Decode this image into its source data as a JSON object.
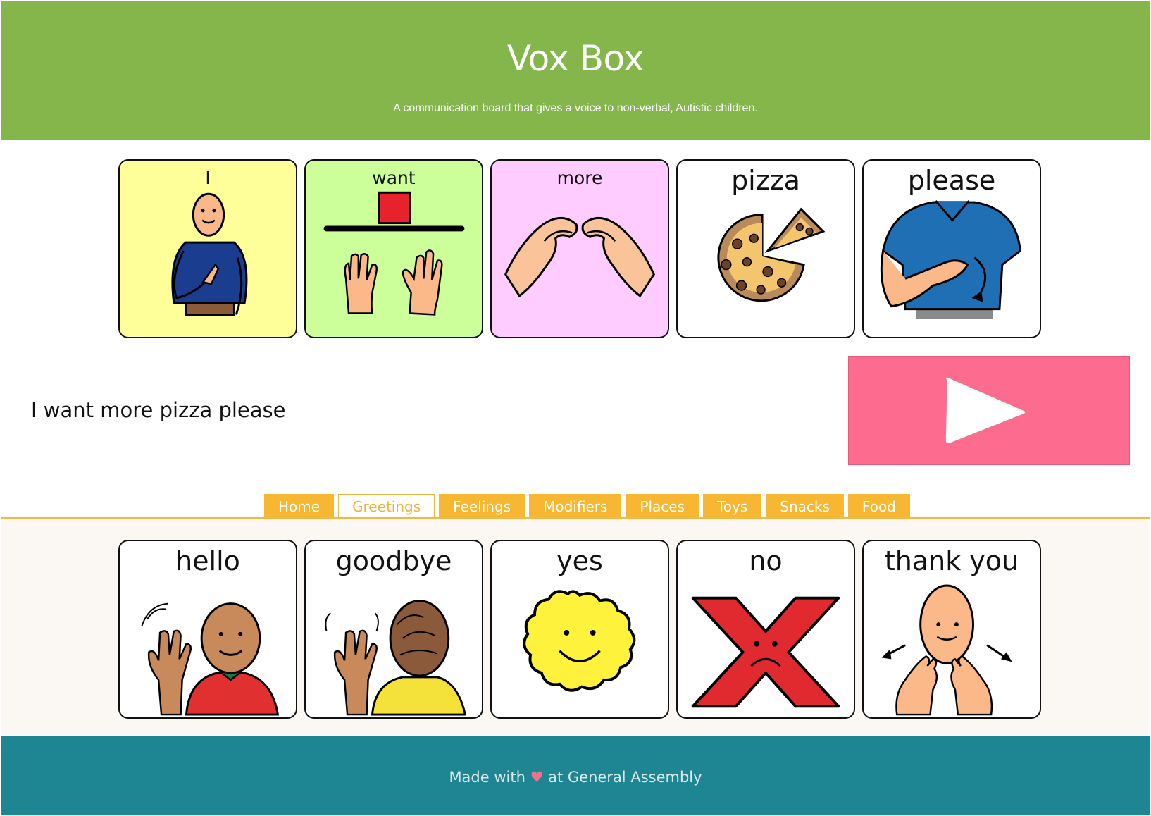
{
  "header": {
    "title": "Vox Box",
    "subtitle": "A communication board that gives a voice to non-verbal, Autistic children."
  },
  "sentence_strip": {
    "cards": [
      {
        "label": "I",
        "icon": "person-pointing-self-icon",
        "bg": "#ffff99"
      },
      {
        "label": "want",
        "icon": "hands-reaching-box-icon",
        "bg": "#ccff99"
      },
      {
        "label": "more",
        "icon": "hands-fingertips-together-icon",
        "bg": "#ffccff"
      },
      {
        "label": "pizza",
        "icon": "pizza-icon",
        "bg": "#ffffff"
      },
      {
        "label": "please",
        "icon": "hand-circling-chest-icon",
        "bg": "#ffffff"
      }
    ]
  },
  "sentence_text": "I want more pizza please",
  "play_button": {
    "icon": "play-icon",
    "color": "#fd6b8e"
  },
  "tabs": {
    "items": [
      "Home",
      "Greetings",
      "Feelings",
      "Modifiers",
      "Places",
      "Toys",
      "Snacks",
      "Food"
    ],
    "active": "Greetings",
    "color": "#f8b733"
  },
  "board": {
    "cards": [
      {
        "label": "hello",
        "icon": "boy-waving-hello-icon"
      },
      {
        "label": "goodbye",
        "icon": "boy-waving-goodbye-icon"
      },
      {
        "label": "yes",
        "icon": "smiley-face-icon"
      },
      {
        "label": "no",
        "icon": "red-x-frown-icon"
      },
      {
        "label": "thank you",
        "icon": "hands-from-chin-icon"
      }
    ]
  },
  "footer": {
    "prefix": "Made with",
    "heart": "♥",
    "suffix": "at General Assembly"
  },
  "colors": {
    "header": "#84b64c",
    "footer": "#1e8693",
    "tab": "#f8b733",
    "play": "#fd6b8e"
  }
}
